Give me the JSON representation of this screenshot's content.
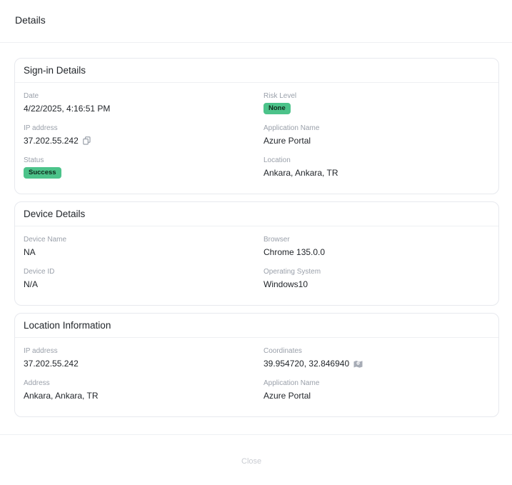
{
  "dialog": {
    "title": "Details"
  },
  "signin": {
    "title": "Sign-in Details",
    "date_label": "Date",
    "date_value": "4/22/2025, 4:16:51 PM",
    "risk_label": "Risk Level",
    "risk_value": "None",
    "ip_label": "IP address",
    "ip_value": "37.202.55.242",
    "app_label": "Application Name",
    "app_value": "Azure Portal",
    "status_label": "Status",
    "status_value": "Success",
    "location_label": "Location",
    "location_value": "Ankara, Ankara, TR"
  },
  "device": {
    "title": "Device Details",
    "name_label": "Device Name",
    "name_value": "NA",
    "browser_label": "Browser",
    "browser_value": "Chrome 135.0.0",
    "id_label": "Device ID",
    "id_value": "N/A",
    "os_label": "Operating System",
    "os_value": "Windows10"
  },
  "location": {
    "title": "Location Information",
    "ip_label": "IP address",
    "ip_value": "37.202.55.242",
    "coords_label": "Coordinates",
    "coords_value": "39.954720, 32.846940",
    "address_label": "Address",
    "address_value": "Ankara, Ankara, TR",
    "app_label": "Application Name",
    "app_value": "Azure Portal"
  },
  "footer": {
    "close_label": "Close"
  },
  "colors": {
    "badge_green": "#4cc38a",
    "label_gray": "#9aa0aa",
    "border": "#e7e9ee"
  },
  "icons": {
    "copy": "copy-icon",
    "map": "map-icon"
  }
}
